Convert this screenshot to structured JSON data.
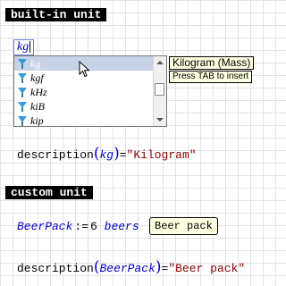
{
  "sections": {
    "builtin_header": "built-in unit",
    "custom_header": "custom unit"
  },
  "unit_input": {
    "value": "kg"
  },
  "autocomplete": {
    "items": [
      {
        "label": "kg",
        "selected": true
      },
      {
        "label": "kgf",
        "selected": false
      },
      {
        "label": "kHz",
        "selected": false
      },
      {
        "label": "kiB",
        "selected": false
      },
      {
        "label": "kip",
        "selected": false
      }
    ],
    "icon": "unit-filter-icon"
  },
  "tooltip": {
    "title": "Kilogram (Mass)",
    "hint": "Press TAB to insert"
  },
  "expr1": {
    "func": "description",
    "arg": "kg",
    "equals": "=",
    "result": "\"Kilogram\""
  },
  "custom_def": {
    "name": "BeerPack",
    "assign": ":=",
    "number": "6",
    "unit": "beers",
    "label": "Beer pack"
  },
  "expr2": {
    "func": "description",
    "arg": "BeerPack",
    "equals": "=",
    "result": "\"Beer pack\""
  },
  "colors": {
    "variable": "#0000c8",
    "string": "#8b0000",
    "tooltip_bg": "#ffffe1",
    "selection": "#c6d3e6"
  }
}
